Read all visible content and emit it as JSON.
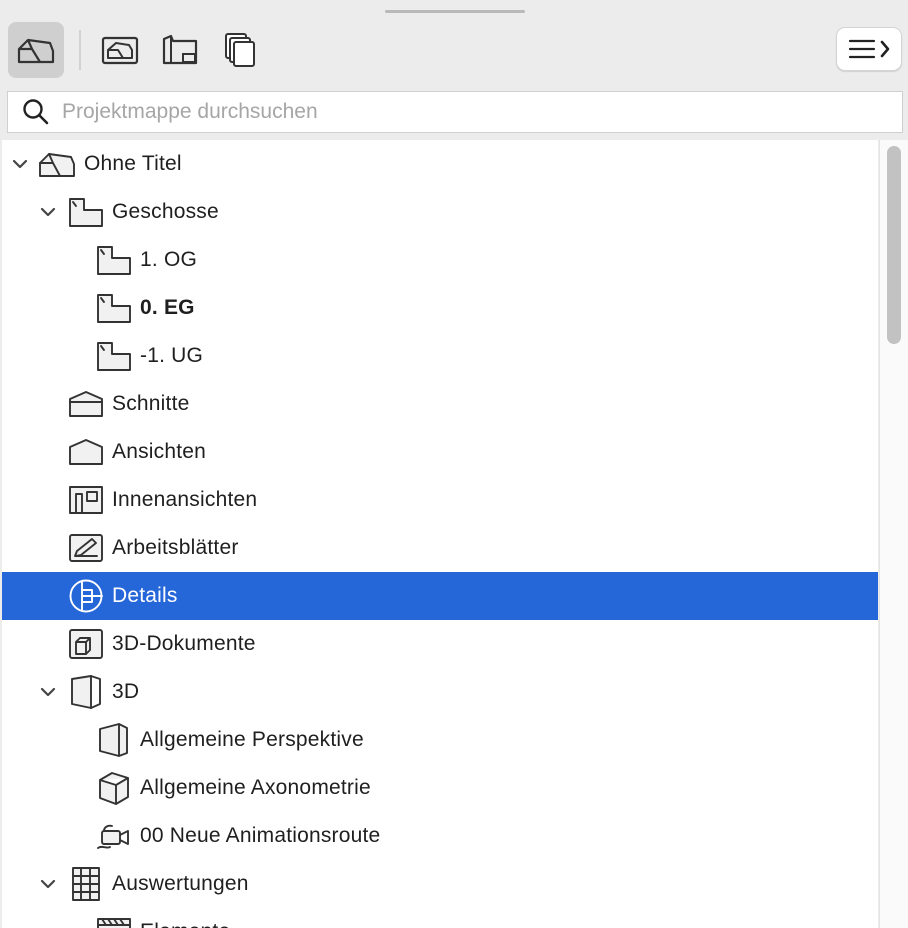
{
  "toolbar": {
    "buttons": [
      {
        "name": "project-map-icon",
        "active": true
      },
      {
        "name": "view-map-icon",
        "active": false
      },
      {
        "name": "layout-book-icon",
        "active": false
      },
      {
        "name": "publisher-sets-icon",
        "active": false
      }
    ],
    "menu_icon": "hamburger-chevron-icon"
  },
  "search": {
    "placeholder": "Projektmappe durchsuchen",
    "value": ""
  },
  "tree": {
    "items": [
      {
        "label": "Ohne Titel",
        "level": 0,
        "expanded": true,
        "icon": "project-house-icon",
        "bold": false,
        "selected": false
      },
      {
        "label": "Geschosse",
        "level": 1,
        "expanded": true,
        "icon": "story-icon",
        "bold": false,
        "selected": false
      },
      {
        "label": "1. OG",
        "level": 2,
        "icon": "story-icon",
        "bold": false,
        "selected": false
      },
      {
        "label": "0. EG",
        "level": 2,
        "icon": "story-icon",
        "bold": true,
        "selected": false
      },
      {
        "label": "-1. UG",
        "level": 2,
        "icon": "story-icon",
        "bold": false,
        "selected": false
      },
      {
        "label": "Schnitte",
        "level": 1,
        "icon": "section-icon",
        "bold": false,
        "selected": false
      },
      {
        "label": "Ansichten",
        "level": 1,
        "icon": "elevation-icon",
        "bold": false,
        "selected": false
      },
      {
        "label": "Innenansichten",
        "level": 1,
        "icon": "interior-elevation-icon",
        "bold": false,
        "selected": false
      },
      {
        "label": "Arbeitsblätter",
        "level": 1,
        "icon": "worksheet-icon",
        "bold": false,
        "selected": false
      },
      {
        "label": "Details",
        "level": 1,
        "icon": "detail-icon",
        "bold": false,
        "selected": true
      },
      {
        "label": "3D-Dokumente",
        "level": 1,
        "icon": "3d-document-icon",
        "bold": false,
        "selected": false
      },
      {
        "label": "3D",
        "level": 1,
        "expanded": true,
        "icon": "3d-icon",
        "bold": false,
        "selected": false
      },
      {
        "label": "Allgemeine Perspektive",
        "level": 2,
        "icon": "perspective-icon",
        "bold": false,
        "selected": false
      },
      {
        "label": "Allgemeine Axonometrie",
        "level": 2,
        "icon": "axonometry-icon",
        "bold": false,
        "selected": false
      },
      {
        "label": "00 Neue Animationsroute",
        "level": 2,
        "icon": "camera-path-icon",
        "bold": false,
        "selected": false
      },
      {
        "label": "Auswertungen",
        "level": 1,
        "expanded": true,
        "icon": "schedule-icon",
        "bold": false,
        "selected": false
      },
      {
        "label": "Elemente",
        "level": 2,
        "icon": "element-schedule-icon",
        "bold": false,
        "selected": false
      }
    ]
  },
  "colors": {
    "selection": "#2566d8",
    "panel_bg": "#ececec",
    "tree_bg": "#ffffff"
  }
}
